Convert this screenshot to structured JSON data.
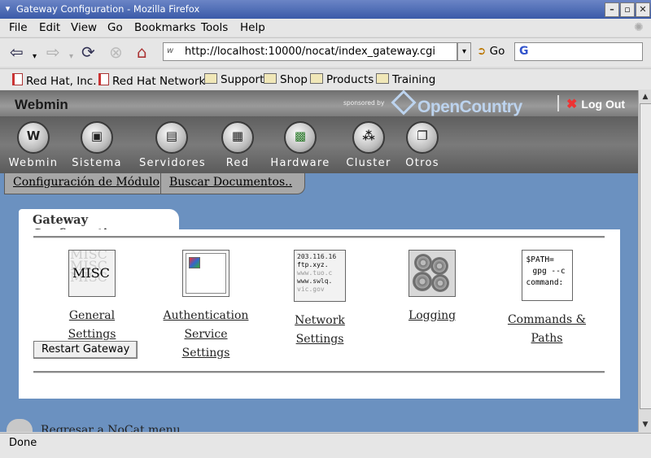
{
  "window": {
    "title": "Gateway Configuration - Mozilla Firefox"
  },
  "menubar": {
    "items": [
      "File",
      "Edit",
      "View",
      "Go",
      "Bookmarks",
      "Tools",
      "Help"
    ]
  },
  "navbar": {
    "url": "http://localhost:10000/nocat/index_gateway.cgi",
    "go_label": "Go"
  },
  "bookmarks": [
    "Red Hat, Inc.",
    "Red Hat Network",
    "Support",
    "Shop",
    "Products",
    "Training"
  ],
  "webmin": {
    "logo": "Webmin",
    "sponsored": "sponsored by",
    "sponsor": "OpenCountry",
    "logout": "Log Out",
    "categories": [
      "Webmin",
      "Sistema",
      "Servidores",
      "Red",
      "Hardware",
      "Cluster",
      "Otros"
    ],
    "module_tabs": [
      "Configuración de Módulo",
      "Buscar Documentos.."
    ]
  },
  "page": {
    "title": "Gateway Configuration",
    "modules": [
      {
        "label_line1": "General Settings",
        "label_line2": ""
      },
      {
        "label_line1": "Authentication",
        "label_line2": "Service Settings"
      },
      {
        "label_line1": "Network Settings",
        "label_line2": ""
      },
      {
        "label_line1": "Logging",
        "label_line2": ""
      },
      {
        "label_line1": "Commands & Paths",
        "label_line2": ""
      }
    ],
    "icon_text": {
      "misc": "MISC",
      "net": [
        "203.116.16",
        "ftp.xyz.",
        "www.tuo.c",
        "www.swlq.",
        "vic.gov"
      ],
      "cmd": [
        "$PATH=",
        "gpg --c",
        "command:"
      ]
    },
    "restart_button": "Restart Gateway",
    "return_link": "Regresar a NoCat menu"
  },
  "status": {
    "text": "Done"
  }
}
